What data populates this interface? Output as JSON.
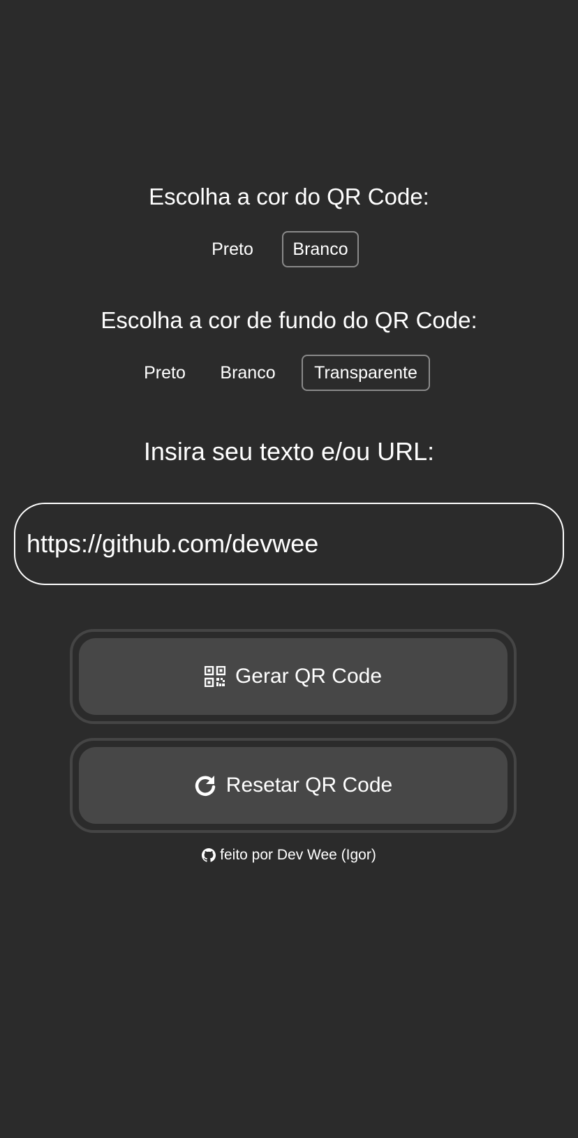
{
  "qr_color": {
    "heading": "Escolha a cor do QR Code:",
    "options": [
      "Preto",
      "Branco"
    ],
    "selected": "Branco"
  },
  "bg_color": {
    "heading": "Escolha a cor de fundo do QR Code:",
    "options": [
      "Preto",
      "Branco",
      "Transparente"
    ],
    "selected": "Transparente"
  },
  "text_input": {
    "heading": "Insira seu texto e/ou URL:",
    "value": "https://github.com/devwee"
  },
  "buttons": {
    "generate_label": "Gerar QR Code",
    "generate_icon": "qrcode-icon",
    "reset_label": "Resetar QR Code",
    "reset_icon": "refresh-icon"
  },
  "footer": {
    "text": "feito por Dev Wee (Igor)",
    "icon": "github-icon"
  },
  "colors": {
    "background": "#2b2b2b",
    "button_fill": "#474747",
    "button_ring": "#454545",
    "selected_border": "#8a8a8a",
    "text": "#ffffff"
  }
}
